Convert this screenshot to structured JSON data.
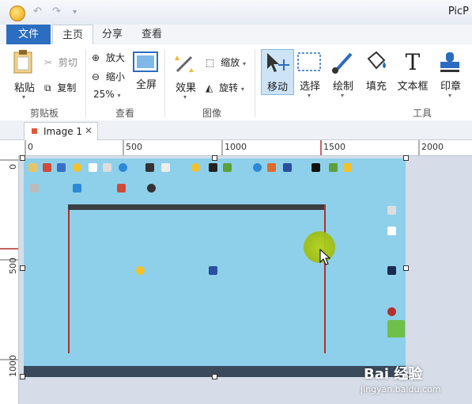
{
  "window": {
    "title": "PicP"
  },
  "quick_access": {
    "undo_icon": "undo-icon",
    "redo_icon": "redo-icon",
    "customize_icon": "dropdown-icon"
  },
  "tabs": [
    {
      "label": "文件"
    },
    {
      "label": "主页"
    },
    {
      "label": "分享"
    },
    {
      "label": "查看"
    }
  ],
  "ribbon": {
    "clipboard": {
      "paste": "粘贴",
      "cut": "剪切",
      "copy": "复制",
      "group": "剪贴板"
    },
    "view": {
      "zoom_in": "放大",
      "zoom_out": "缩小",
      "zoom_level": "25%",
      "fullscreen": "全屏",
      "group": "查看"
    },
    "image": {
      "effects": "效果",
      "resize": "缩放",
      "rotate": "旋转",
      "group": "图像"
    },
    "tools": {
      "move": "移动",
      "select": "选择",
      "draw": "绘制",
      "fill": "填充",
      "textbox": "文本框",
      "stamp": "印章",
      "group": "工具"
    }
  },
  "document": {
    "tab_name": "Image 1"
  },
  "ruler": {
    "h_marks": [
      "0",
      "500",
      "1000",
      "1500",
      "2000"
    ],
    "v_marks": [
      "0",
      "500",
      "1000"
    ]
  },
  "watermark": {
    "brand": "Bai 经验",
    "url": "jingyan.baidu.com"
  }
}
